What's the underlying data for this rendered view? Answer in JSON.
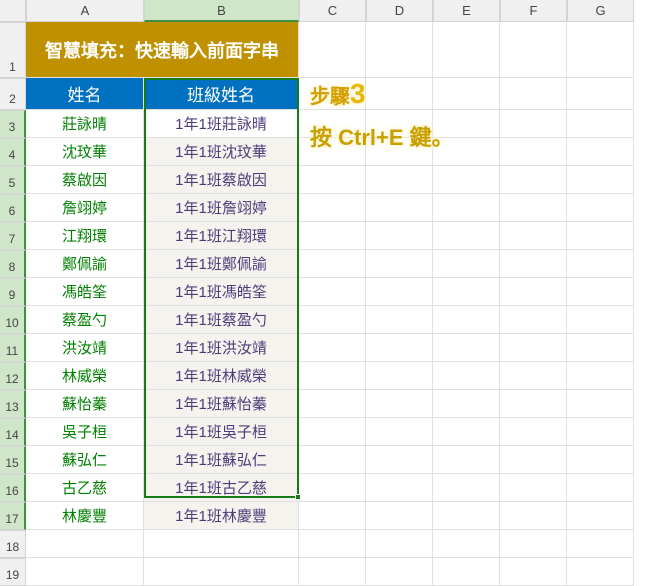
{
  "columns": [
    "A",
    "B",
    "C",
    "D",
    "E",
    "F",
    "G"
  ],
  "rows": [
    "1",
    "2",
    "3",
    "4",
    "5",
    "6",
    "7",
    "8",
    "9",
    "10",
    "11",
    "12",
    "13",
    "14",
    "15",
    "16",
    "17",
    "18",
    "19"
  ],
  "title": "智慧填充：快速輸入前面字串",
  "headers": {
    "name": "姓名",
    "classname": "班級姓名"
  },
  "data": [
    {
      "name": "莊詠晴",
      "classname": "1年1班莊詠晴"
    },
    {
      "name": "沈玟華",
      "classname": "1年1班沈玟華"
    },
    {
      "name": "蔡啟因",
      "classname": "1年1班蔡啟因"
    },
    {
      "name": "詹翊婷",
      "classname": "1年1班詹翊婷"
    },
    {
      "name": "江翔環",
      "classname": "1年1班江翔環"
    },
    {
      "name": "鄭佩諭",
      "classname": "1年1班鄭佩諭"
    },
    {
      "name": "馮皓筌",
      "classname": "1年1班馮皓筌"
    },
    {
      "name": "蔡盈勺",
      "classname": "1年1班蔡盈勺"
    },
    {
      "name": "洪汝靖",
      "classname": "1年1班洪汝靖"
    },
    {
      "name": "林威榮",
      "classname": "1年1班林威榮"
    },
    {
      "name": "蘇怡蓁",
      "classname": "1年1班蘇怡蓁"
    },
    {
      "name": "吳子桓",
      "classname": "1年1班吳子桓"
    },
    {
      "name": "蘇弘仁",
      "classname": "1年1班蘇弘仁"
    },
    {
      "name": "古乙慈",
      "classname": "1年1班古乙慈"
    },
    {
      "name": "林慶豐",
      "classname": "1年1班林慶豐"
    }
  ],
  "annotation": {
    "step_label": "步驟",
    "step_num": "3",
    "instruction": "按 Ctrl+E 鍵。"
  }
}
